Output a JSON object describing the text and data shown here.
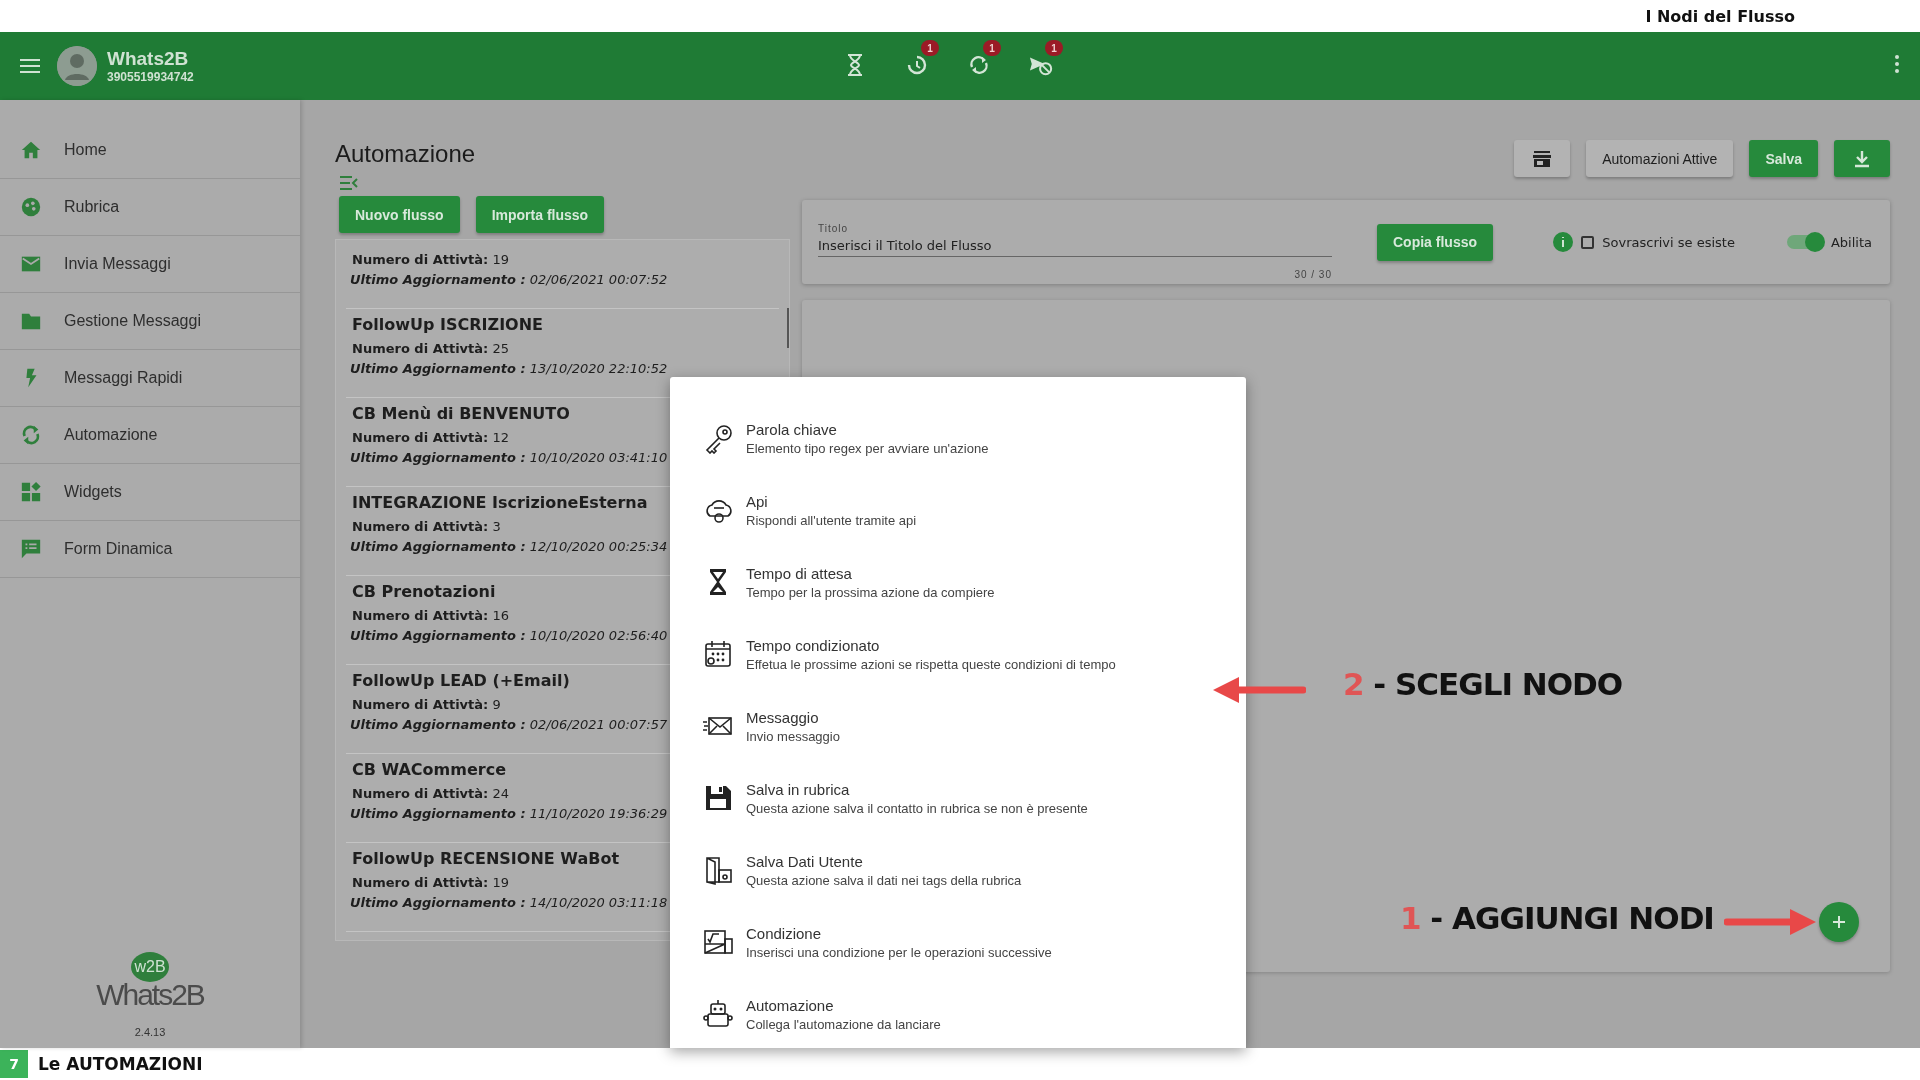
{
  "document": {
    "header": "I Nodi del Flusso",
    "page_number": "7",
    "footer": "Le AUTOMAZIONI"
  },
  "app_bar": {
    "name": "Whats2B",
    "phone": "3905519934742",
    "status_icons": [
      {
        "kind": "hourglass"
      },
      {
        "kind": "timer",
        "badge": "1"
      },
      {
        "kind": "sync",
        "badge": "1"
      },
      {
        "kind": "send-off",
        "badge": "1"
      }
    ]
  },
  "sidebar": {
    "items": [
      "Home",
      "Rubrica",
      "Invia Messaggi",
      "Gestione Messaggi",
      "Messaggi Rapidi",
      "Automazione",
      "Widgets",
      "Form Dinamica"
    ],
    "logo": {
      "mark": "w2B",
      "name": "Whats2B"
    },
    "version": "2.4.13"
  },
  "main": {
    "title": "Automazione",
    "buttons": [
      "Nuovo flusso",
      "Importa flusso"
    ],
    "flows": [
      {
        "count": "**Numero di Attivtà:** 19",
        "updated": "**Ultimo Aggiornamento :** 02/06/2021 00:07:52"
      },
      {
        "title": "FollowUp ISCRIZIONE",
        "count": "**Numero di Attivtà:** 25",
        "updated": "**Ultimo Aggiornamento :** 13/10/2020 22:10:52"
      },
      {
        "title": "CB Menù di BENVENUTO",
        "count": "**Numero di Attivtà:** 12",
        "updated": "**Ultimo Aggiornamento :** 10/10/2020 03:41:10"
      },
      {
        "title": "INTEGRAZIONE IscrizioneEsterna",
        "count": "**Numero di Attivtà:** 3",
        "updated": "**Ultimo Aggiornamento :** 12/10/2020 00:25:34"
      },
      {
        "title": "CB Prenotazioni",
        "count": "**Numero di Attivtà:** 16",
        "updated": "**Ultimo Aggiornamento :** 10/10/2020 02:56:40"
      },
      {
        "title": "FollowUp LEAD (+Email)",
        "count": "**Numero di Attivtà:** 9",
        "updated": "**Ultimo Aggiornamento :** 02/06/2021 00:07:57"
      },
      {
        "title": "CB WACommerce",
        "count": "**Numero di Attivtà:** 24",
        "updated": "**Ultimo Aggiornamento :** 11/10/2020 19:36:29"
      },
      {
        "title": "FollowUp RECENSIONE WaBot",
        "count": "**Numero di Attivtà:** 19",
        "updated": "**Ultimo Aggiornamento :** 14/10/2020 03:11:18"
      }
    ],
    "toolbar": [
      {
        "kind": "store"
      },
      {
        "kind": "text",
        "label": "Automazioni Attive",
        "primary": false
      },
      {
        "kind": "text",
        "label": "Salva",
        "primary": true
      },
      {
        "kind": "download"
      }
    ],
    "title_card": {
      "label": "Titolo",
      "value": "Inserisci il Titolo del Flusso",
      "counter": "30 / 30",
      "copy_button": "Copia flusso",
      "overwrite": {
        "label": "Sovrascrivi se esiste",
        "checked": false
      },
      "enable": {
        "label": "Abilita",
        "on": true
      }
    }
  },
  "node_menu": [
    {
      "kind": "key",
      "title": "Parola chiave",
      "description": "Elemento tipo regex per avviare un'azione"
    },
    {
      "kind": "api",
      "title": "Api",
      "description": "Rispondi all'utente tramite api"
    },
    {
      "kind": "hourglass",
      "title": "Tempo di attesa",
      "description": "Tempo per la prossima azione da compiere"
    },
    {
      "kind": "calendar",
      "title": "Tempo condizionato",
      "description": "Effetua le prossime azioni se rispetta queste condizioni di tempo"
    },
    {
      "kind": "mail",
      "title": "Messaggio",
      "description": "Invio messaggio"
    },
    {
      "kind": "floppy",
      "title": "Salva in rubrica",
      "description": "Questa azione salva il contatto in rubrica se non è presente"
    },
    {
      "kind": "folder",
      "title": "Salva Dati Utente",
      "description": "Questa azione salva il dati nei tags della rubrica"
    },
    {
      "kind": "formula",
      "title": "Condizione",
      "description": "Inserisci una condizione per le operazioni successive"
    },
    {
      "kind": "robot",
      "title": "Automazione",
      "description": "Collega l'automazione da lanciare"
    }
  ],
  "annotations": [
    {
      "number": "2",
      "text": "- SCEGLI NODO"
    },
    {
      "number": "1",
      "text": "- AGGIUNGI NODI"
    }
  ]
}
